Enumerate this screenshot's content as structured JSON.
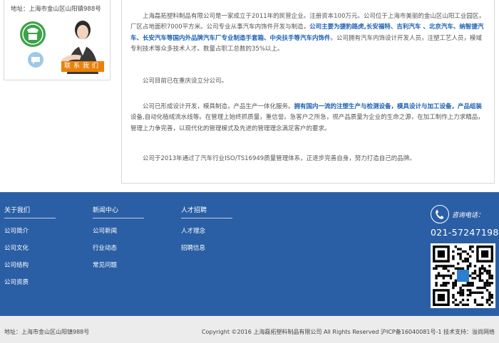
{
  "contact": {
    "address": "地址：上海市金山区山阳镇988号",
    "button_label": "联系我们"
  },
  "intro": {
    "p1_a": "上海磊拓塑料制品有限公司是一家成立于2011年的民营企业。注册资本100万元。公司位于上海市美丽的金山区山阳工业园区，厂区占地面积7000平方米。公司专业从事汽车内饰件开发与制造，",
    "p1_b": "公司主要为捷豹路虎,长安福特、吉利汽车 、北京汽车、纳智捷汽车、长安汽车等国内外品牌汽车厂专业制造手套箱、中央扶手等汽车内饰件",
    "p1_c": "。公司拥有汽车内饰设计开发人员，注塑工艺人员，模域专利技术等众多技术人才。数量占职工总数的35%以上。",
    "p2": "公司目前已在重庆设立分公司。",
    "p3_a": "公司已形成设计开发，模具制造，产品生产一体化服务。",
    "p3_b": "拥有国内一流的注塑生产与检测设备，模具设计与加工设备，产品组装",
    "p3_c": "设备,自动化植绒流水线等。在管理上始终抓质量，重信誉。急客户之所急，视产品质量为企业的生命之源，在加工制作上力求精品，管理上力争完善，以现代化的管理模式及先进的管理理念满足客户的要求。",
    "p4": "公司于2013年通过了汽车行业ISO/TS16949质量管理体系，正逐步完善自身，努力打造自己的品牌。"
  },
  "footer": {
    "col1": {
      "title": "关于我们",
      "items": [
        "公司简介",
        "公司文化",
        "公司结构",
        "公司资质"
      ]
    },
    "col2": {
      "title": "新闻中心",
      "items": [
        "公司新闻",
        "行业动态",
        "常见问题"
      ]
    },
    "col3": {
      "title": "人才招聘",
      "items": [
        "人才理念",
        "招聘信息"
      ]
    },
    "phone_label": "咨询电话：",
    "phone_number": "021-57247198"
  },
  "bottom": {
    "address": "地址：上海市金山区山阳镇988号",
    "copyright": "Copyright ©2016 上海磊拓塑料制品有限公司 All Rights Reserved 沪ICP备16040081号-1 技术支持：溢尚网络"
  },
  "colors": {
    "footer_bg": "#2b5fa5",
    "highlight": "#1a5fb4",
    "contact_button": "#e8820c"
  }
}
